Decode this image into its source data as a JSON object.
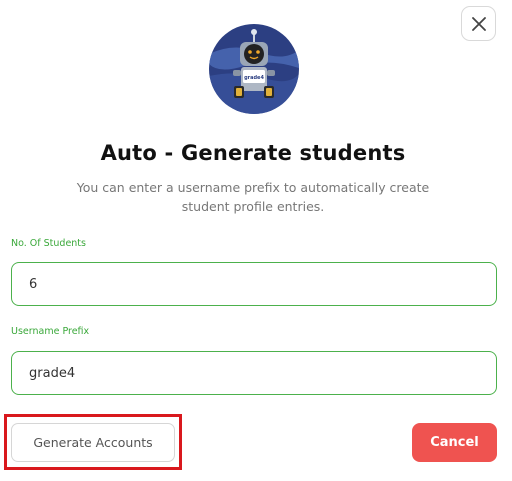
{
  "dialog": {
    "title": "Auto - Generate students",
    "description": "You can enter a username prefix to automatically create student profile entries.",
    "close_icon": "close-icon",
    "avatar_icon": "robot-mascot",
    "robot_sign_text": "grade4"
  },
  "form": {
    "students_label": "No. Of Students",
    "students_value": "6",
    "prefix_label": "Username Prefix",
    "prefix_value": "grade4"
  },
  "buttons": {
    "generate_label": "Generate Accounts",
    "cancel_label": "Cancel"
  },
  "colors": {
    "label_green": "#3aa83a",
    "input_border": "#4cb14c",
    "cancel_bg": "#ef5350",
    "highlight_red": "#d9181d"
  }
}
